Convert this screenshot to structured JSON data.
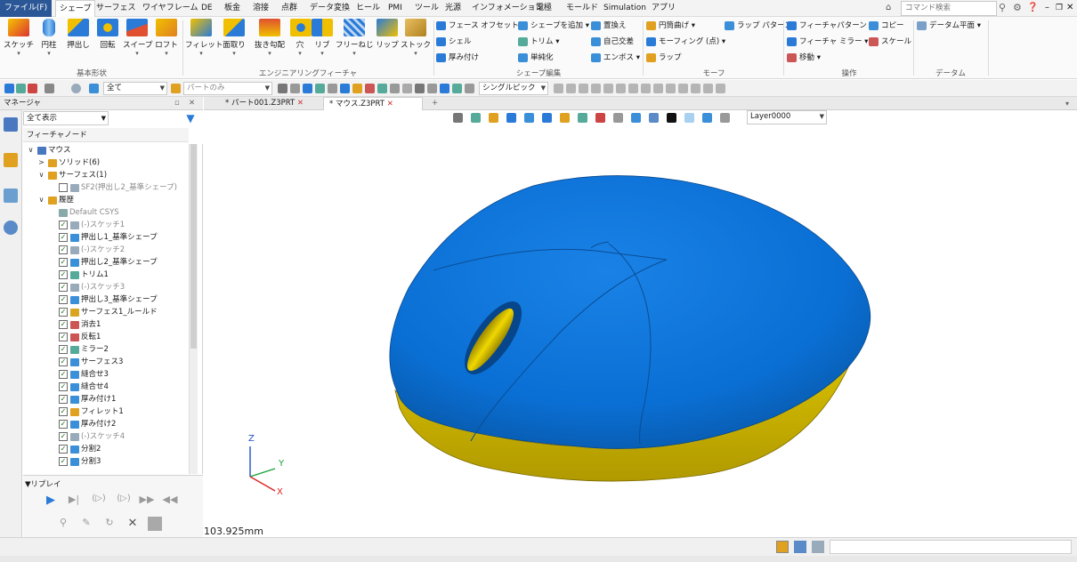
{
  "menubar": {
    "file": "ファイル(F)",
    "tabs": [
      "シェープ",
      "サーフェス",
      "ワイヤフレーム",
      "DE",
      "板金",
      "溶接",
      "点群",
      "データ変換",
      "ヒール",
      "PMI",
      "ツール",
      "光源",
      "インフォメーション",
      "電極",
      "モールド",
      "Simulation",
      "アプリ"
    ],
    "command_search": "コマンド検索"
  },
  "ribbon": {
    "basic": [
      "スケッチ",
      "円柱",
      "押出し",
      "回転",
      "スイープ",
      "ロフト"
    ],
    "eng": [
      "フィレット",
      "面取り",
      "抜き勾配",
      "穴",
      "リブ",
      "フリーねじ",
      "リップ",
      "ストック"
    ],
    "shape_edit": [
      "フェース オフセット",
      "シェル",
      "厚み付け",
      "シェープを追加",
      "トリム",
      "単純化",
      "置換え",
      "自己交差",
      "エンボス"
    ],
    "morph": [
      "円筒曲げ",
      "モーフィング (点)",
      "ラップ",
      "ラップ パターン"
    ],
    "ops": [
      "フィーチャパターン",
      "フィーチャ ミラー",
      "移動",
      "コピー",
      "スケール"
    ],
    "datum": [
      "データム平面"
    ],
    "groups": [
      "基本形状",
      "エンジニアリングフィーチャ",
      "シェープ編集",
      "モーフ",
      "操作",
      "データム"
    ]
  },
  "toolbar2": {
    "filter_value": "全て",
    "part_value": "パートのみ",
    "pick_value": "シングルピック"
  },
  "manager": {
    "title": "マネージャ",
    "filter": "全て表示",
    "header": "フィーチャノード",
    "replay": "▼リプレイ"
  },
  "tree": [
    {
      "label": "マウス",
      "lvl": 0,
      "tw": "∨",
      "cb": "",
      "color": "#4a78c0"
    },
    {
      "label": "ソリッド(6)",
      "lvl": 1,
      "tw": ">",
      "cb": "",
      "color": "#e0a020"
    },
    {
      "label": "サーフェス(1)",
      "lvl": 1,
      "tw": "∨",
      "cb": "",
      "color": "#e0a020"
    },
    {
      "label": "SF2(押出し2_基準シェープ)",
      "lvl": 2,
      "tw": "",
      "cb": "off",
      "color": "#9ab",
      "gray": true
    },
    {
      "label": "履歴",
      "lvl": 1,
      "tw": "∨",
      "cb": "",
      "color": "#e0a020"
    },
    {
      "label": "Default CSYS",
      "lvl": 2,
      "tw": "",
      "cb": "",
      "color": "#8aa",
      "gray": true
    },
    {
      "label": "(-)スケッチ1",
      "lvl": 2,
      "tw": "",
      "cb": "on",
      "color": "#9ab",
      "gray": true
    },
    {
      "label": "押出し1_基準シェープ",
      "lvl": 2,
      "tw": "",
      "cb": "on",
      "color": "#3a8fd8"
    },
    {
      "label": "(-)スケッチ2",
      "lvl": 2,
      "tw": "",
      "cb": "on",
      "color": "#9ab",
      "gray": true
    },
    {
      "label": "押出し2_基準シェープ",
      "lvl": 2,
      "tw": "",
      "cb": "on",
      "color": "#3a8fd8"
    },
    {
      "label": "トリム1",
      "lvl": 2,
      "tw": "",
      "cb": "on",
      "color": "#5a9"
    },
    {
      "label": "(-)スケッチ3",
      "lvl": 2,
      "tw": "",
      "cb": "on",
      "color": "#9ab",
      "gray": true
    },
    {
      "label": "押出し3_基準シェープ",
      "lvl": 2,
      "tw": "",
      "cb": "on",
      "color": "#3a8fd8"
    },
    {
      "label": "サーフェス1_ルールド",
      "lvl": 2,
      "tw": "",
      "cb": "on",
      "color": "#d9a520"
    },
    {
      "label": "消去1",
      "lvl": 2,
      "tw": "",
      "cb": "on",
      "color": "#c55"
    },
    {
      "label": "反転1",
      "lvl": 2,
      "tw": "",
      "cb": "on",
      "color": "#c55"
    },
    {
      "label": "ミラー2",
      "lvl": 2,
      "tw": "",
      "cb": "on",
      "color": "#5a9"
    },
    {
      "label": "サーフェス3",
      "lvl": 2,
      "tw": "",
      "cb": "on",
      "color": "#3a8fd8"
    },
    {
      "label": "縫合せ3",
      "lvl": 2,
      "tw": "",
      "cb": "on",
      "color": "#3a8fd8"
    },
    {
      "label": "縫合せ4",
      "lvl": 2,
      "tw": "",
      "cb": "on",
      "color": "#3a8fd8"
    },
    {
      "label": "厚み付け1",
      "lvl": 2,
      "tw": "",
      "cb": "on",
      "color": "#3a8fd8"
    },
    {
      "label": "フィレット1",
      "lvl": 2,
      "tw": "",
      "cb": "on",
      "color": "#e0a020"
    },
    {
      "label": "厚み付け2",
      "lvl": 2,
      "tw": "",
      "cb": "on",
      "color": "#3a8fd8"
    },
    {
      "label": "(-)スケッチ4",
      "lvl": 2,
      "tw": "",
      "cb": "on",
      "color": "#9ab",
      "gray": true
    },
    {
      "label": "分割2",
      "lvl": 2,
      "tw": "",
      "cb": "on",
      "color": "#3a8fd8"
    },
    {
      "label": "分割3",
      "lvl": 2,
      "tw": "",
      "cb": "on",
      "color": "#3a8fd8"
    }
  ],
  "doc_tabs": [
    "* パート001.Z3PRT",
    "* マウス.Z3PRT"
  ],
  "viewport": {
    "layer": "Layer0000",
    "scale": "103.925mm",
    "axis_x": "X",
    "axis_y": "Y",
    "axis_z": "Z"
  },
  "colors": {
    "body_blue": "#0a6fd4",
    "base_yellow": "#d2b800",
    "file_menu": "#2b5797"
  }
}
